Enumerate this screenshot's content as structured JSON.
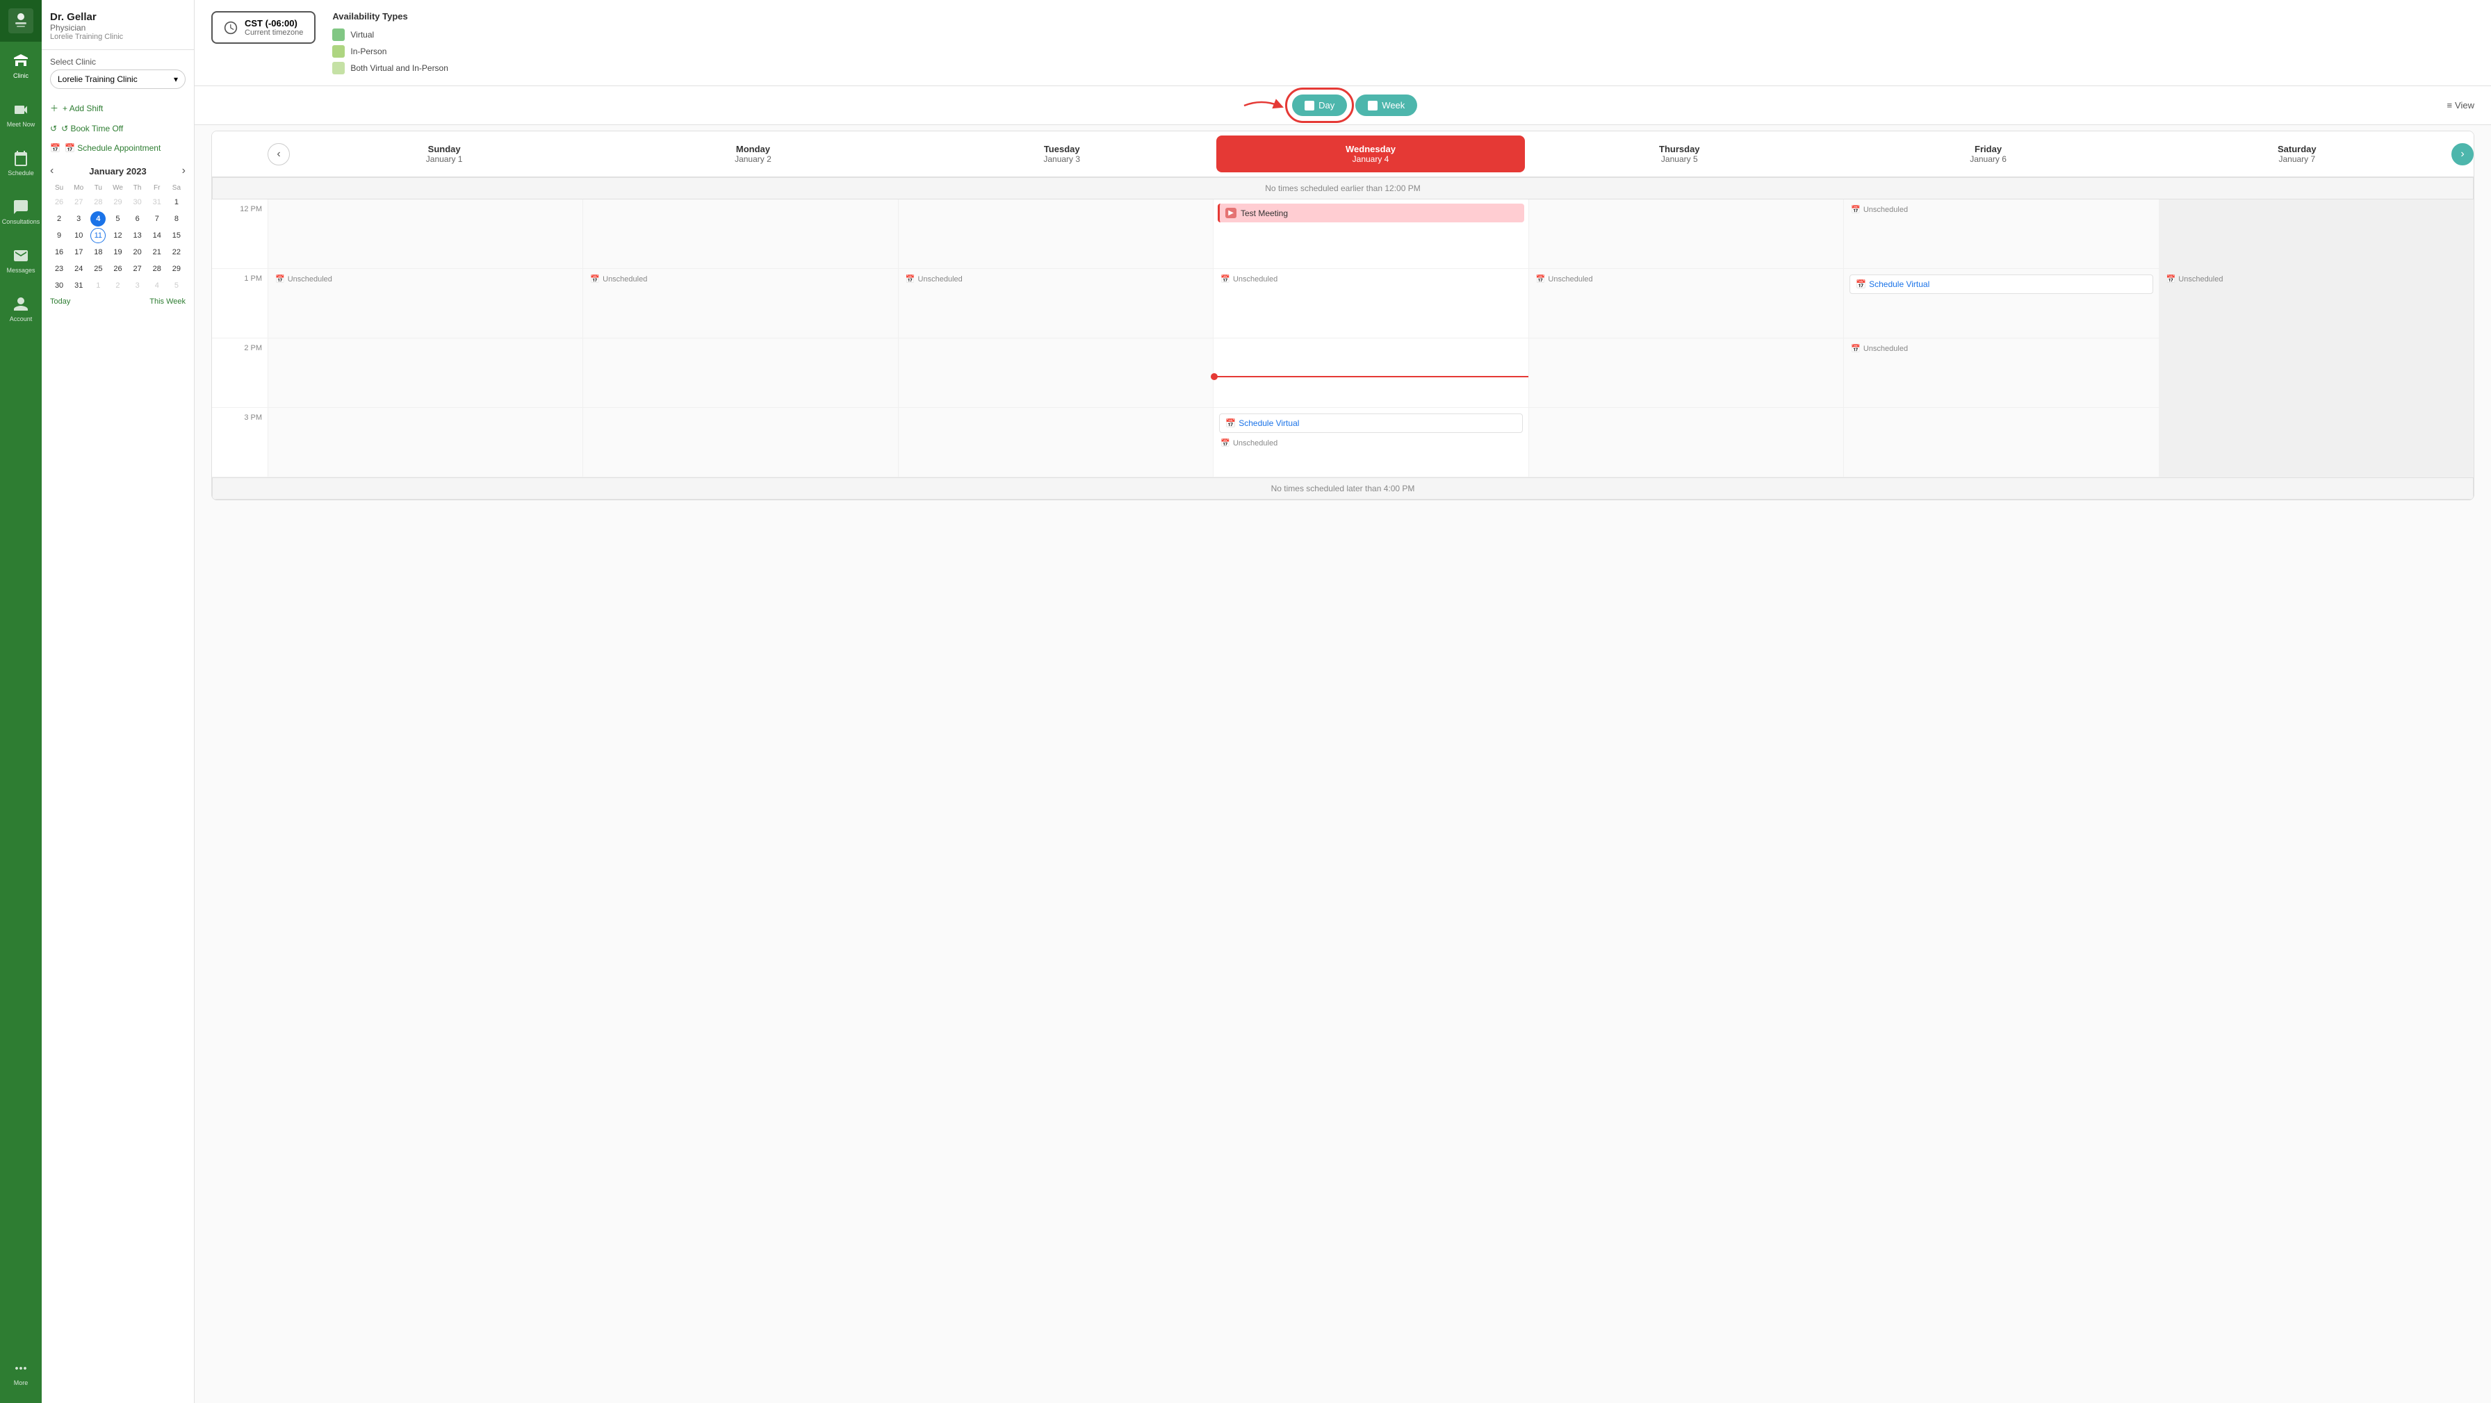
{
  "sidebar": {
    "logo_alt": "Saskatchewan Logo",
    "items": [
      {
        "id": "clinic",
        "label": "Clinic",
        "active": true
      },
      {
        "id": "meet-now",
        "label": "Meet Now",
        "active": false
      },
      {
        "id": "schedule",
        "label": "Schedule",
        "active": false
      },
      {
        "id": "consultations",
        "label": "Consultations",
        "active": false
      },
      {
        "id": "messages",
        "label": "Messages",
        "active": false
      },
      {
        "id": "account",
        "label": "Account",
        "active": false
      }
    ],
    "more_label": "More"
  },
  "doctor": {
    "name": "Dr. Gellar",
    "title": "Physician",
    "clinic": "Lorelie Training Clinic"
  },
  "panel": {
    "select_clinic_label": "Select Clinic",
    "clinic_name": "Lorelie Training Clinic",
    "add_shift": "+ Add Shift",
    "book_time_off": "↺ Book Time Off",
    "schedule_appointment": "📅 Schedule Appointment"
  },
  "mini_calendar": {
    "month_year": "January 2023",
    "day_headers": [
      "Su",
      "Mo",
      "Tu",
      "We",
      "Th",
      "Fr",
      "Sa"
    ],
    "weeks": [
      [
        {
          "d": "26",
          "other": true
        },
        {
          "d": "27",
          "other": true
        },
        {
          "d": "28",
          "other": true
        },
        {
          "d": "29",
          "other": true
        },
        {
          "d": "30",
          "other": true
        },
        {
          "d": "31",
          "other": true
        },
        {
          "d": "1",
          "other": false
        }
      ],
      [
        {
          "d": "2"
        },
        {
          "d": "3"
        },
        {
          "d": "4",
          "selected": true
        },
        {
          "d": "5"
        },
        {
          "d": "6"
        },
        {
          "d": "7"
        },
        {
          "d": "8"
        }
      ],
      [
        {
          "d": "9"
        },
        {
          "d": "10"
        },
        {
          "d": "11",
          "today": true
        },
        {
          "d": "12"
        },
        {
          "d": "13"
        },
        {
          "d": "14"
        },
        {
          "d": "15"
        }
      ],
      [
        {
          "d": "16"
        },
        {
          "d": "17"
        },
        {
          "d": "18"
        },
        {
          "d": "19"
        },
        {
          "d": "20"
        },
        {
          "d": "21"
        },
        {
          "d": "22"
        }
      ],
      [
        {
          "d": "23"
        },
        {
          "d": "24"
        },
        {
          "d": "25"
        },
        {
          "d": "26"
        },
        {
          "d": "27"
        },
        {
          "d": "28"
        },
        {
          "d": "29"
        }
      ],
      [
        {
          "d": "30"
        },
        {
          "d": "31"
        },
        {
          "d": "1",
          "other": true
        },
        {
          "d": "2",
          "other": true
        },
        {
          "d": "3",
          "other": true
        },
        {
          "d": "4",
          "other": true
        },
        {
          "d": "5",
          "other": true
        }
      ]
    ],
    "today_link": "Today",
    "this_week_link": "This Week"
  },
  "timezone": {
    "name": "CST (-06:00)",
    "sub": "Current timezone"
  },
  "availability_types": {
    "title": "Availability Types",
    "items": [
      {
        "label": "Virtual",
        "color": "#81c784"
      },
      {
        "label": "In-Person",
        "color": "#aed581"
      },
      {
        "label": "Both Virtual and In-Person",
        "color": "#c5e1a5"
      }
    ]
  },
  "view_toggle": {
    "day_label": "Day",
    "week_label": "Week",
    "view_label": "View"
  },
  "calendar": {
    "days": [
      {
        "name": "Sunday",
        "date": "January 1",
        "today": false
      },
      {
        "name": "Monday",
        "date": "January 2",
        "today": false
      },
      {
        "name": "Tuesday",
        "date": "January 3",
        "today": false
      },
      {
        "name": "Wednesday",
        "date": "January 4",
        "today": true
      },
      {
        "name": "Thursday",
        "date": "January 5",
        "today": false
      },
      {
        "name": "Friday",
        "date": "January 6",
        "today": false
      },
      {
        "name": "Saturday",
        "date": "January 7",
        "today": false
      }
    ],
    "no_earlier": "No times scheduled earlier than 12:00 PM",
    "no_later": "No times scheduled later than 4:00 PM",
    "time_slots": [
      {
        "label": "12 PM",
        "cells": [
          {
            "type": "empty"
          },
          {
            "type": "empty"
          },
          {
            "type": "empty"
          },
          {
            "type": "meeting",
            "title": "Test Meeting"
          },
          {
            "type": "empty"
          },
          {
            "type": "unscheduled"
          },
          {
            "type": "empty"
          }
        ]
      },
      {
        "label": "1 PM",
        "cells": [
          {
            "type": "unscheduled"
          },
          {
            "type": "unscheduled"
          },
          {
            "type": "unscheduled"
          },
          {
            "type": "unscheduled"
          },
          {
            "type": "unscheduled"
          },
          {
            "type": "schedule-virtual"
          },
          {
            "type": "unscheduled"
          }
        ]
      },
      {
        "label": "2 PM",
        "cells": [
          {
            "type": "empty"
          },
          {
            "type": "empty"
          },
          {
            "type": "empty"
          },
          {
            "type": "time-indicator"
          },
          {
            "type": "empty"
          },
          {
            "type": "unscheduled"
          },
          {
            "type": "empty"
          }
        ]
      },
      {
        "label": "3 PM",
        "cells": [
          {
            "type": "empty"
          },
          {
            "type": "empty"
          },
          {
            "type": "empty"
          },
          {
            "type": "schedule-virtual-unscheduled"
          },
          {
            "type": "empty"
          },
          {
            "type": "empty"
          },
          {
            "type": "empty"
          }
        ]
      }
    ]
  }
}
